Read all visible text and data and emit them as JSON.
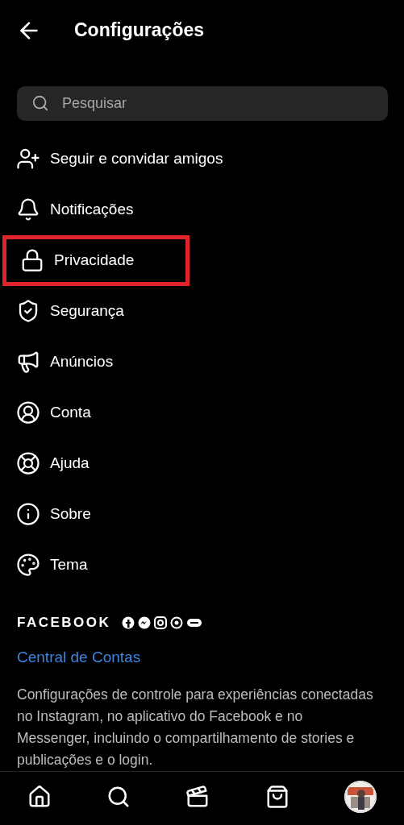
{
  "header": {
    "title": "Configurações"
  },
  "search": {
    "placeholder": "Pesquisar"
  },
  "menu": [
    {
      "kind": "add-person",
      "label": "Seguir e convidar amigos",
      "highlighted": false
    },
    {
      "kind": "bell",
      "label": "Notificações",
      "highlighted": false
    },
    {
      "kind": "lock",
      "label": "Privacidade",
      "highlighted": true
    },
    {
      "kind": "shield",
      "label": "Segurança",
      "highlighted": false
    },
    {
      "kind": "megaphone",
      "label": "Anúncios",
      "highlighted": false
    },
    {
      "kind": "account",
      "label": "Conta",
      "highlighted": false
    },
    {
      "kind": "lifebuoy",
      "label": "Ajuda",
      "highlighted": false
    },
    {
      "kind": "info",
      "label": "Sobre",
      "highlighted": false
    },
    {
      "kind": "palette",
      "label": "Tema",
      "highlighted": false
    }
  ],
  "facebook_section": {
    "title": "FACEBOOK",
    "link": "Central de Contas",
    "description": "Configurações de controle para experiências conectadas no Instagram, no aplicativo do Facebook e no Messenger, incluindo o compartilhamento de stories e publicações e o login."
  },
  "bottom_nav": [
    {
      "kind": "home"
    },
    {
      "kind": "search"
    },
    {
      "kind": "reels"
    },
    {
      "kind": "shop"
    },
    {
      "kind": "profile"
    }
  ]
}
